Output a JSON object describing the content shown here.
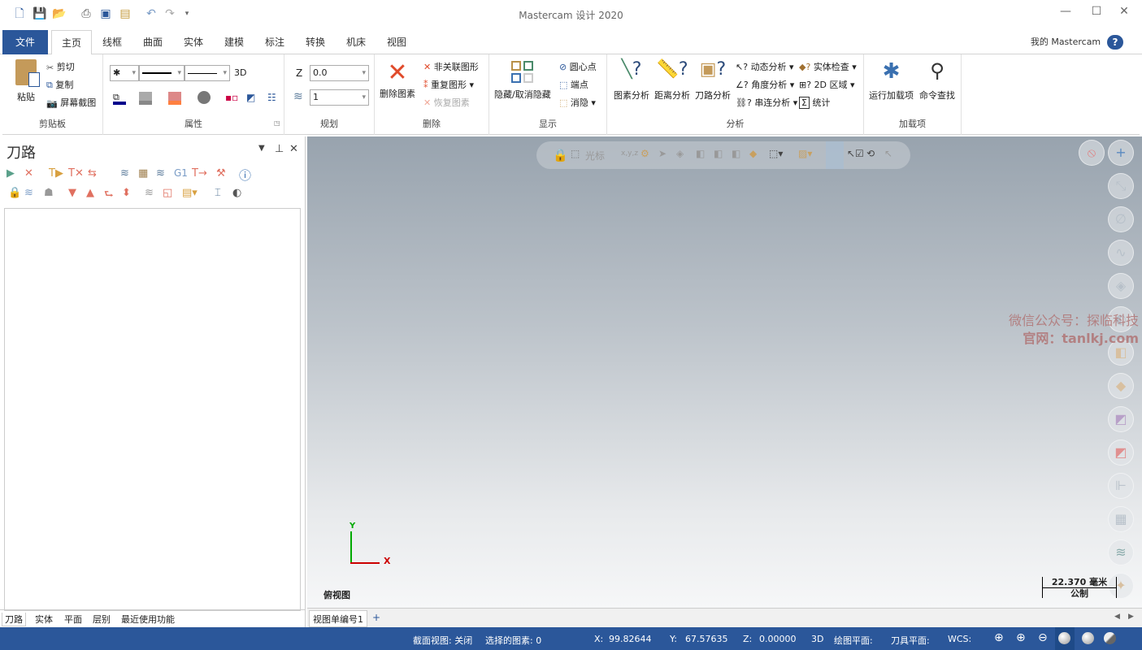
{
  "window": {
    "title": "Mastercam 设计 2020",
    "minimize": "—",
    "maximize": "☐",
    "close": "✕"
  },
  "ribbon_tabs": [
    "文件",
    "主页",
    "线框",
    "曲面",
    "实体",
    "建模",
    "标注",
    "转换",
    "机床",
    "视图"
  ],
  "account": {
    "label": "我的 Mastercam",
    "help": "?"
  },
  "clipboard": {
    "label": "剪贴板",
    "paste": "粘贴",
    "cut": "剪切",
    "copy": "复制",
    "screenshot": "屏幕截图"
  },
  "attributes": {
    "label": "属性",
    "mode_3d": "3D"
  },
  "planning": {
    "label": "规划",
    "z_label": "Z",
    "z_value": "0.0",
    "level_value": "1"
  },
  "delete": {
    "label": "删除",
    "delete_entities": "删除图素",
    "non_assoc": "非关联图形",
    "duplicates": "重复图形",
    "restore": "恢复图素"
  },
  "display": {
    "label": "显示",
    "hide_unhide": "隐藏/取消隐藏",
    "center_point": "圆心点",
    "endpoints": "端点",
    "blank": "消隐"
  },
  "analyze": {
    "label": "分析",
    "entity": "图素分析",
    "distance": "距离分析",
    "toolpath": "刀路分析",
    "dynamic": "动态分析",
    "angle": "角度分析",
    "chain": "串连分析",
    "solid_check": "实体检查",
    "area_2d": "2D 区域",
    "statistics": "统计"
  },
  "addins": {
    "label": "加载项",
    "run": "运行加载项",
    "find": "命令查找"
  },
  "panel": {
    "title": "刀路",
    "g1": "G1",
    "tabs": [
      "刀路",
      "实体",
      "平面",
      "层别",
      "最近使用功能"
    ]
  },
  "viewport": {
    "toolbar_cursor": "光标",
    "xyz": "x,y,z",
    "view_name": "俯视图",
    "axis_x": "X",
    "axis_y": "Y",
    "scale_value": "22.370 毫米",
    "scale_unit": "公制",
    "watermark_line1": "微信公众号：探临科技",
    "watermark_line2": "官网：tanlkj.com"
  },
  "view_tabs": {
    "current": "视图单编号1",
    "add": "+"
  },
  "status": {
    "section_view": "截面视图: 关闭",
    "selected": "选择的图素: 0",
    "x_label": "X:",
    "x": "99.82644",
    "y_label": "Y:",
    "y": "67.57635",
    "z_label": "Z:",
    "z": "0.00000",
    "mode": "3D",
    "cplane": "绘图平面:",
    "tplane": "刀具平面:",
    "wcs": "WCS:"
  },
  "colors": {
    "accent": "#2b579a",
    "delete_red": "#e04a2a"
  }
}
